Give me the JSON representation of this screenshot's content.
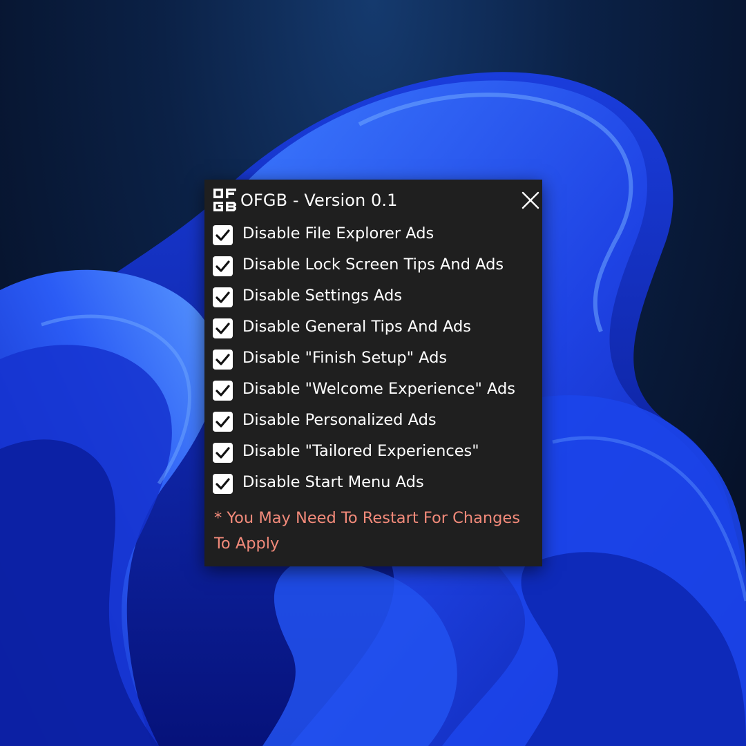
{
  "desktop": {
    "wallpaper_icon": "windows-bloom-wallpaper"
  },
  "window": {
    "logo_text": [
      "OF",
      "GB"
    ],
    "title": "OFGB - Version 0.1",
    "close_icon": "close-icon",
    "accent_colors": {
      "background": "#1f1f1f",
      "text": "#ffffff",
      "note": "#f28a7a"
    }
  },
  "options": [
    {
      "label": "Disable File Explorer Ads",
      "checked": true
    },
    {
      "label": "Disable Lock Screen Tips And Ads",
      "checked": true
    },
    {
      "label": "Disable Settings Ads",
      "checked": true
    },
    {
      "label": "Disable General Tips And Ads",
      "checked": true
    },
    {
      "label": "Disable \"Finish Setup\" Ads",
      "checked": true
    },
    {
      "label": "Disable \"Welcome Experience\" Ads",
      "checked": true
    },
    {
      "label": "Disable Personalized Ads",
      "checked": true
    },
    {
      "label": "Disable \"Tailored Experiences\"",
      "checked": true
    },
    {
      "label": "Disable Start Menu Ads",
      "checked": true
    }
  ],
  "note": "* You May Need To Restart For Changes To Apply"
}
